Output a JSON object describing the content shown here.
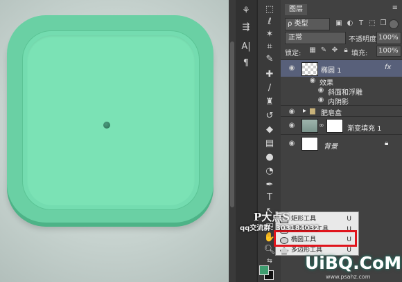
{
  "canvas": {
    "icon_color": "#6ad0a4",
    "inner_color": "#7be2b5",
    "dot_color": "#2e6e56"
  },
  "layers_panel": {
    "tab_label": "图层",
    "menu_icon": "panel-menu-icon",
    "filter": {
      "kind_label": "ρ 类型"
    },
    "blend_mode": "正常",
    "opacity": {
      "label": "不透明度:",
      "value": "100%"
    },
    "lock": {
      "label": "锁定:"
    },
    "fill": {
      "label": "填充:",
      "value": "100%"
    },
    "layers": [
      {
        "name": "椭圆 1",
        "fx": "fx",
        "selected": true
      },
      {
        "name": "效果"
      },
      {
        "name": "斜面和浮雕"
      },
      {
        "name": "内阴影"
      },
      {
        "name": "肥皂盒"
      },
      {
        "name": "渐变填充 1"
      },
      {
        "name": "背景"
      }
    ]
  },
  "tool_popup": {
    "items": [
      {
        "label": "矩形工具",
        "key": "U"
      },
      {
        "label": "圆角矩形工具",
        "key": "U"
      },
      {
        "label": "椭圆工具",
        "key": "U",
        "selected": true
      },
      {
        "label": "多边形工具",
        "key": "U"
      }
    ],
    "highlight_color": "#e0141c"
  },
  "watermark": {
    "title": "P大点S",
    "qq": "qq交流群: 303184032",
    "logo": "UiBQ.CoM",
    "url": "www.psahz.com"
  },
  "colors": {
    "foreground": "#3e9c6f",
    "background": "#111111"
  }
}
